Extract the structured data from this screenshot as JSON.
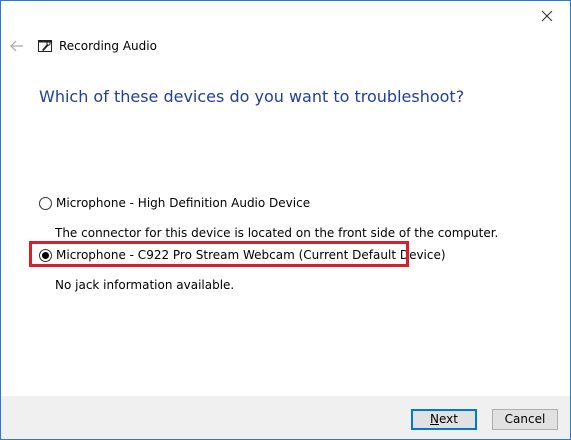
{
  "window": {
    "title": "Recording Audio",
    "close_icon": "close-icon",
    "back_icon": "back-arrow-icon",
    "app_icon": "troubleshooter-icon",
    "border_color": "#2b79d6"
  },
  "content": {
    "heading": "Which of these devices do you want to troubleshoot?",
    "heading_color": "#1f3f9a",
    "devices": [
      {
        "label": "Microphone - High Definition Audio Device",
        "description": "The connector for this device is located on the front side of the computer.",
        "selected": false
      },
      {
        "label": "Microphone - C922 Pro Stream Webcam (Current Default Device)",
        "description": "No jack information available.",
        "selected": true
      }
    ],
    "highlight_color": "#d7202b"
  },
  "footer": {
    "next_accel": "N",
    "next_rest": "ext",
    "cancel_label": "Cancel",
    "default_button_color": "#0078d7"
  }
}
